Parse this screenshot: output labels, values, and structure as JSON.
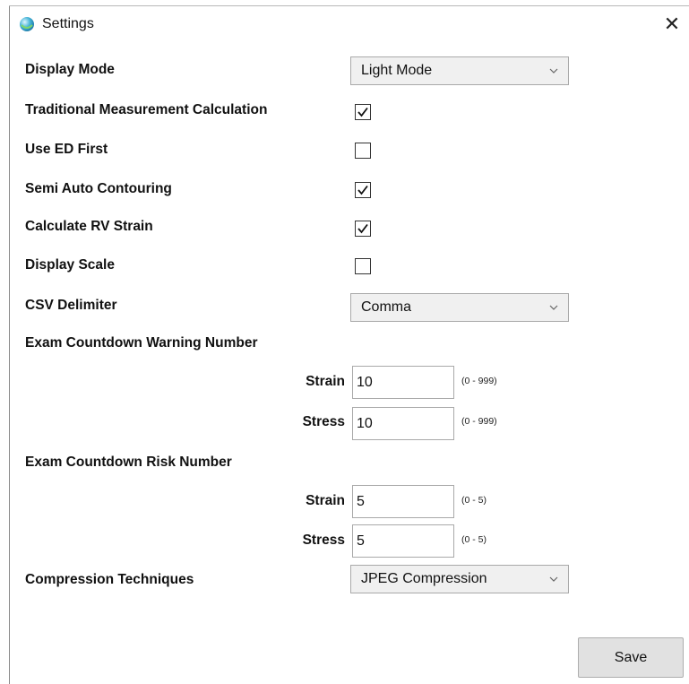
{
  "window": {
    "title": "Settings",
    "close_glyph": "✕"
  },
  "settings": {
    "display_mode": {
      "label": "Display Mode",
      "value": "Light Mode"
    },
    "traditional_measurement": {
      "label": "Traditional Measurement Calculation",
      "checked": true
    },
    "use_ed_first": {
      "label": "Use ED First",
      "checked": false
    },
    "semi_auto_contouring": {
      "label": "Semi Auto Contouring",
      "checked": true
    },
    "calculate_rv_strain": {
      "label": "Calculate RV Strain",
      "checked": true
    },
    "display_scale": {
      "label": "Display Scale",
      "checked": false
    },
    "csv_delimiter": {
      "label": "CSV Delimiter",
      "value": "Comma"
    },
    "exam_warning": {
      "label": "Exam Countdown Warning Number",
      "strain": {
        "label": "Strain",
        "value": "10",
        "range": "(0 - 999)"
      },
      "stress": {
        "label": "Stress",
        "value": "10",
        "range": "(0 - 999)"
      }
    },
    "exam_risk": {
      "label": "Exam Countdown Risk Number",
      "strain": {
        "label": "Strain",
        "value": "5",
        "range": "(0 - 5)"
      },
      "stress": {
        "label": "Stress",
        "value": "5",
        "range": "(0 - 5)"
      }
    },
    "compression": {
      "label": "Compression Techniques",
      "value": "JPEG Compression"
    }
  },
  "actions": {
    "save_label": "Save"
  },
  "icons": {
    "app": "app-orb-icon",
    "close": "close-icon",
    "chevron": "chevron-down-icon",
    "check": "checkmark-icon"
  }
}
